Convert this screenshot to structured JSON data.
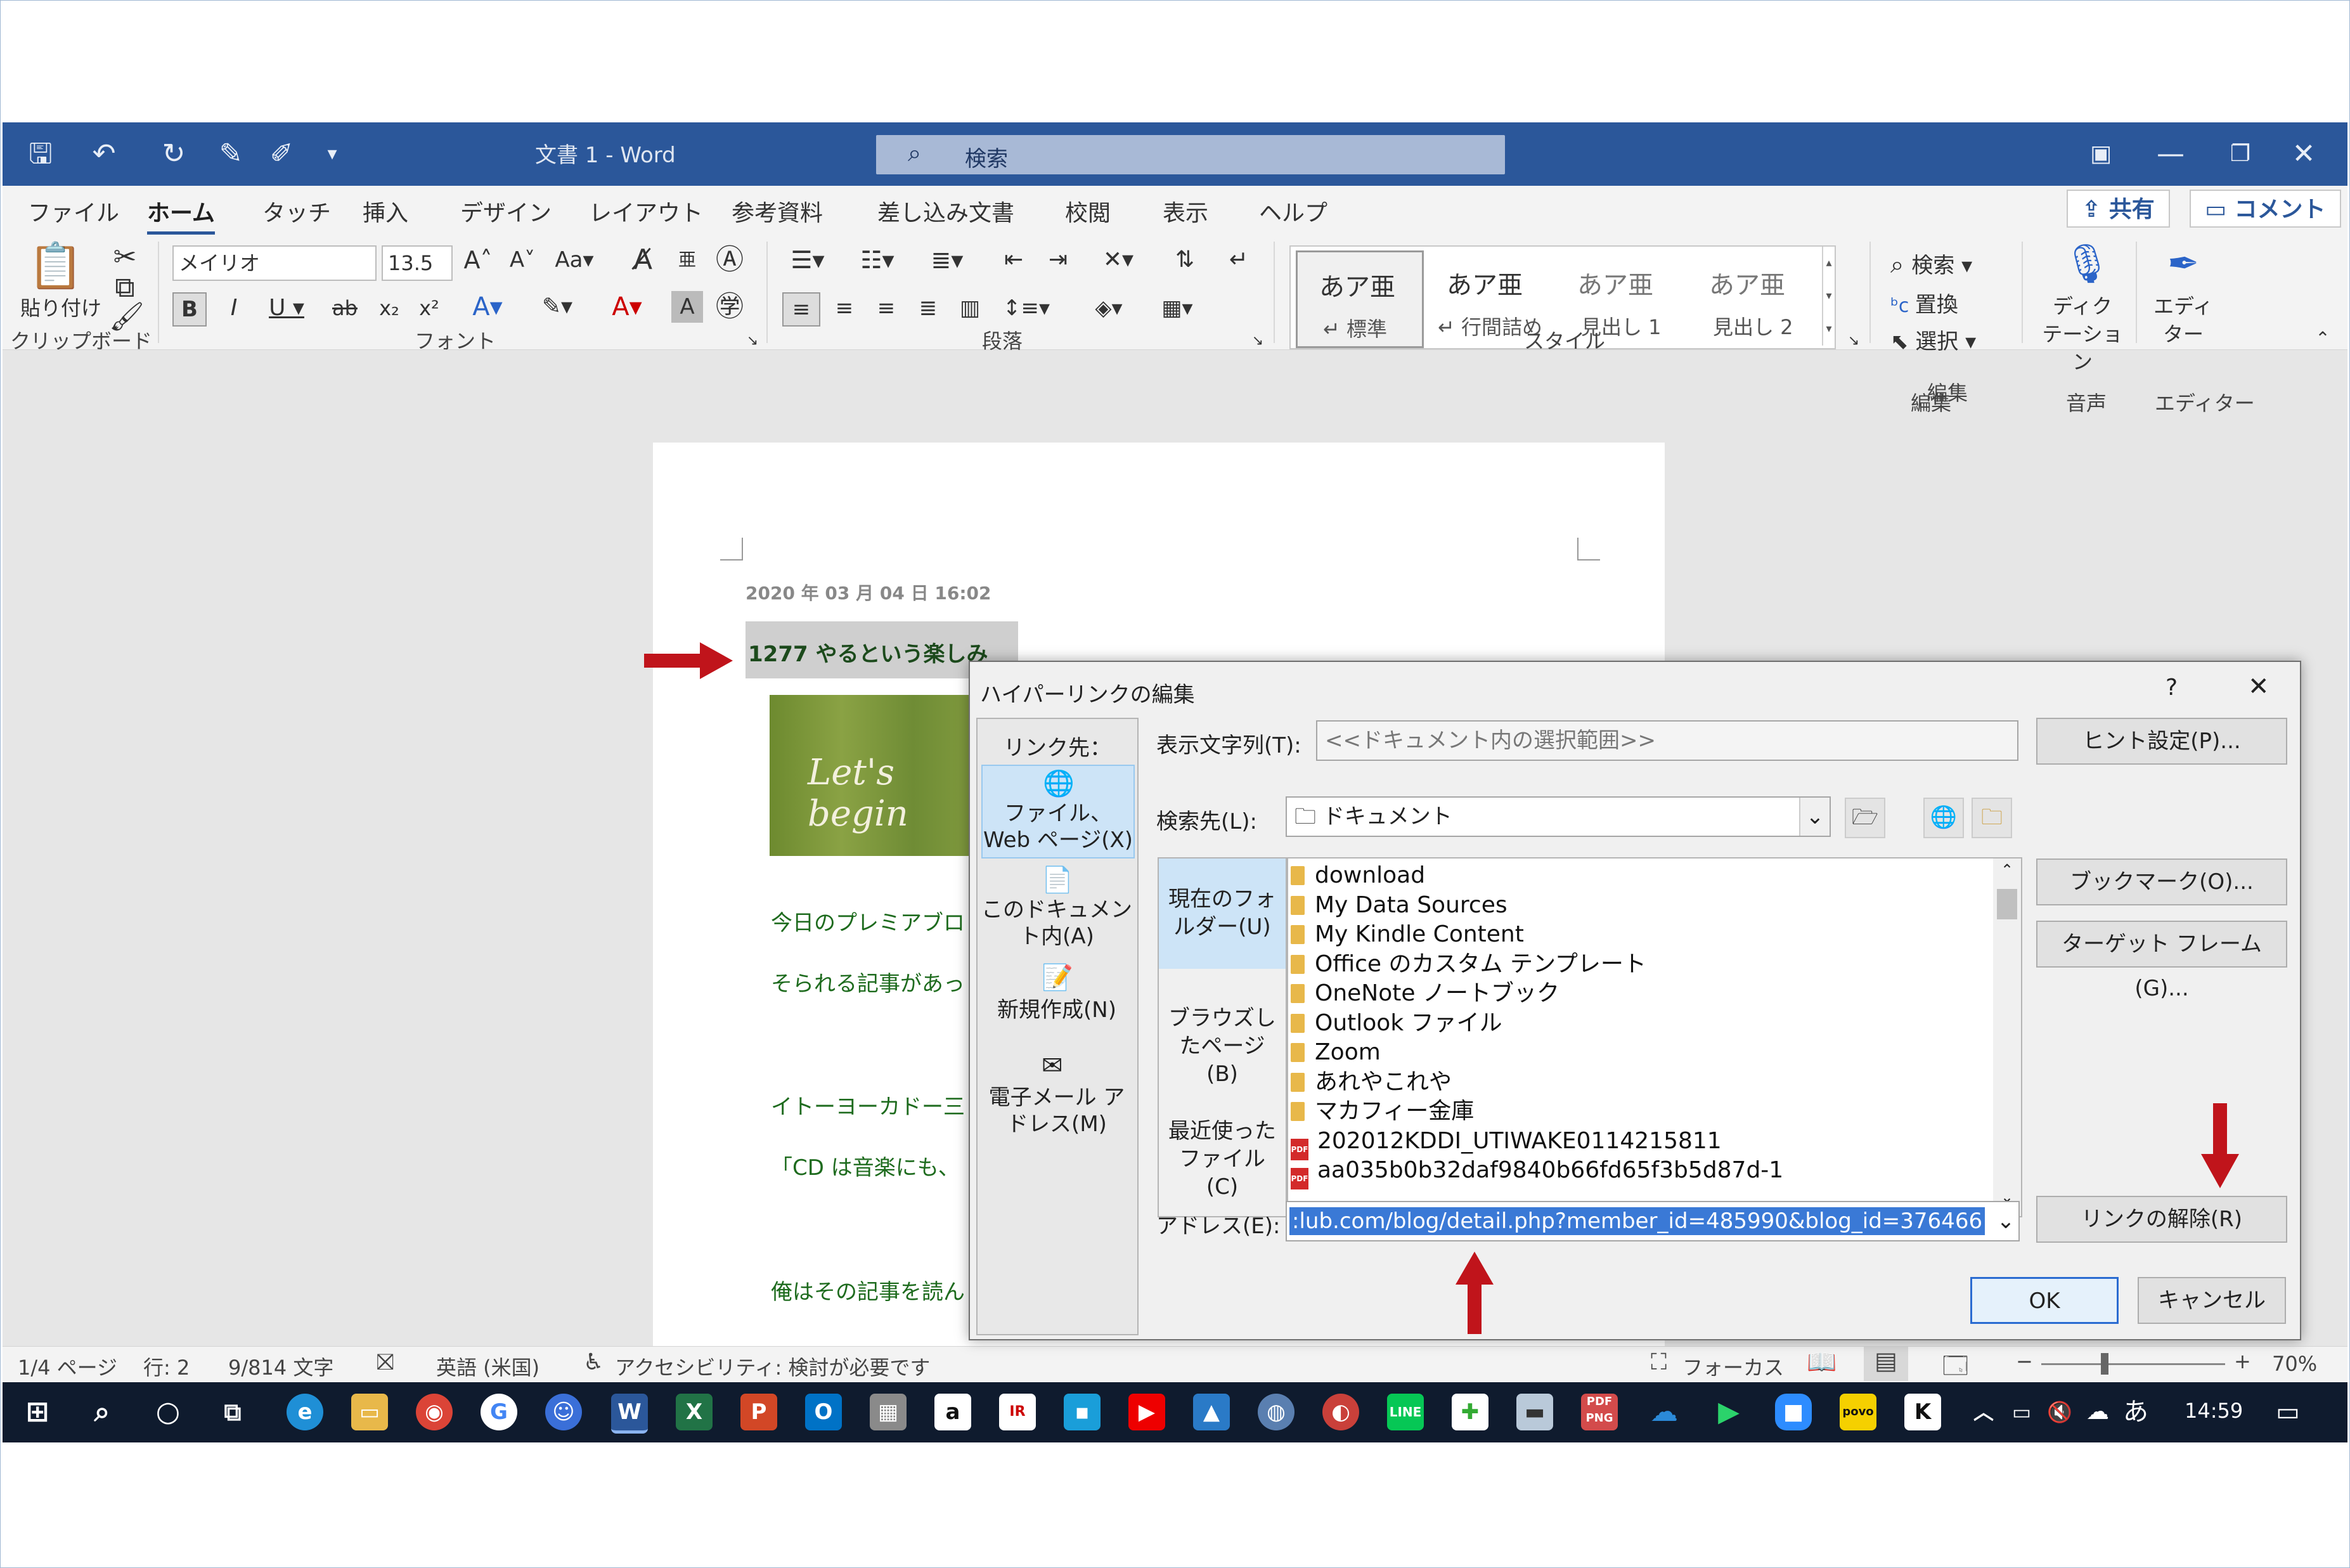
{
  "window": {
    "title": "文書 1 - Word",
    "search_placeholder": "検索"
  },
  "tabs": [
    "ファイル",
    "ホーム",
    "タッチ",
    "挿入",
    "デザイン",
    "レイアウト",
    "参考資料",
    "差し込み文書",
    "校閲",
    "表示",
    "ヘルプ"
  ],
  "header_buttons": {
    "share": "共有",
    "comment": "コメント"
  },
  "ribbon": {
    "paste_label": "貼り付け",
    "font_name": "メイリオ",
    "font_size": "13.5",
    "styles": [
      {
        "sample": "あア亜",
        "name": "↵ 標準"
      },
      {
        "sample": "あア亜",
        "name": "↵ 行間詰め"
      },
      {
        "sample": "あア亜",
        "name": "見出し 1"
      },
      {
        "sample": "あア亜",
        "name": "見出し 2"
      }
    ],
    "edit_search": "検索",
    "edit_replace": "置換",
    "edit_select": "選択",
    "dictate": "ディク\nテーション",
    "editor": "エディ\nター",
    "groups": {
      "clipboard": "クリップボード",
      "font": "フォント",
      "paragraph": "段落",
      "style": "スタイル",
      "edit": "編集",
      "voice": "音声",
      "editor": "エディター"
    }
  },
  "document": {
    "date": "2020 年 03 月 04 日 16:02",
    "heading": "1277 やるという楽しみ",
    "image_text": "Let's begin",
    "lines": [
      "今日のプレミアブロ",
      "そられる記事があっ",
      "イトーヨーカドー三",
      "「CD は音楽にも、",
      "俺はその記事を読ん"
    ]
  },
  "status": {
    "page": "1/4 ページ",
    "line": "行: 2",
    "words": "9/814 文字",
    "lang": "英語 (米国)",
    "access": "アクセシビリティ: 検討が必要です",
    "focus": "フォーカス",
    "zoom": "70%"
  },
  "taskbar": {
    "time": "14:59",
    "ime": "あ"
  },
  "dialog": {
    "title": "ハイパーリンクの編集",
    "help": "?",
    "link_to": "リンク先：",
    "nav": [
      {
        "label": "ファイル、Web ページ(X)"
      },
      {
        "label": "このドキュメント内(A)"
      },
      {
        "label": "新規作成(N)"
      },
      {
        "label": "電子メール アドレス(M)"
      }
    ],
    "display_text_label": "表示文字列(T):",
    "display_text_value": "<<ドキュメント内の選択範囲>>",
    "hint_button": "ヒント設定(P)...",
    "lookin_label": "検索先(L):",
    "lookin_value": "ドキュメント",
    "side_tabs": [
      "現在のフォルダー(U)",
      "ブラウズしたページ(B)",
      "最近使ったファイル(C)"
    ],
    "files": [
      {
        "name": "download",
        "type": "folder"
      },
      {
        "name": "My Data Sources",
        "type": "folder"
      },
      {
        "name": "My Kindle Content",
        "type": "folder"
      },
      {
        "name": "Office のカスタム テンプレート",
        "type": "folder"
      },
      {
        "name": "OneNote ノートブック",
        "type": "folder"
      },
      {
        "name": "Outlook ファイル",
        "type": "folder"
      },
      {
        "name": "Zoom",
        "type": "folder"
      },
      {
        "name": "あれやこれや",
        "type": "folder"
      },
      {
        "name": "マカフィー金庫",
        "type": "folder"
      },
      {
        "name": "202012KDDI_UTIWAKE0114215811",
        "type": "pdf"
      },
      {
        "name": "aa035b0b32daf9840b66fd65f3b5d87d-1",
        "type": "pdf"
      }
    ],
    "bookmark_button": "ブックマーク(O)...",
    "target_button": "ターゲット フレーム(G)...",
    "address_label": "アドレス(E):",
    "address_value": ":lub.com/blog/detail.php?member_id=485990&blog_id=376466",
    "remove_link_button": "リンクの解除(R)",
    "ok": "OK",
    "cancel": "キャンセル"
  },
  "colors": {
    "word_blue": "#2b579a",
    "arrow_red": "#c0141b",
    "doc_green": "#1e6b1e"
  }
}
